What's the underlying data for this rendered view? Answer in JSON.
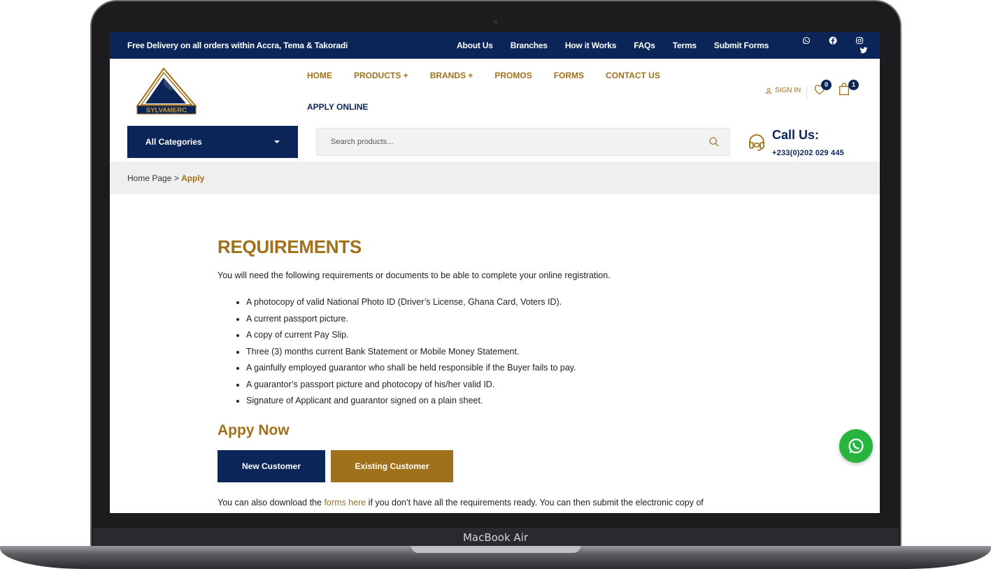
{
  "device": {
    "label": "MacBook Air"
  },
  "topbar": {
    "promo": "Free Delivery on all orders within Accra, Tema & Takoradi",
    "links": [
      "About Us",
      "Branches",
      "How it Works",
      "FAQs",
      "Terms",
      "Submit Forms"
    ],
    "social_icons": [
      "whatsapp-icon",
      "facebook-icon",
      "instagram-icon",
      "twitter-icon"
    ]
  },
  "header": {
    "logo_text": "SYLVAMERC",
    "nav": [
      "HOME",
      "PRODUCTS +",
      "BRANDS +",
      "PROMOS",
      "FORMS",
      "CONTACT US"
    ],
    "nav_second_row": "APPLY ONLINE",
    "signin": "SIGN IN",
    "wishlist_count": "0",
    "cart_count": "1"
  },
  "searchrow": {
    "categories_label": "All Categories",
    "search_placeholder": "Search products...",
    "call_title": "Call Us:",
    "call_number": "+233(0)202 029 445"
  },
  "breadcrumb": {
    "home": "Home Page",
    "separator": " > ",
    "current": "Apply"
  },
  "main": {
    "heading": "REQUIREMENTS",
    "intro": "You will need the following requirements or documents to be able to complete your online registration.",
    "requirements": [
      "A photocopy of valid National Photo ID (Driver’s License, Ghana Card, Voters ID).",
      "A current passport picture.",
      "A copy of current Pay Slip.",
      "Three (3) months current Bank Statement or Mobile Money Statement.",
      "A gainfully employed guarantor who shall be held responsible if the Buyer fails to pay.",
      "A guarantor’s passport picture and photocopy of his/her valid ID.",
      "Signature of Applicant and guarantor signed on a plain sheet."
    ],
    "apply_heading": "Appy Now",
    "btn_new": "New Customer",
    "btn_existing": "Existing Customer",
    "footer_pre": "You can also download the ",
    "footer_link": "forms here",
    "footer_post": " if you don’t have all the requirements ready. You can then submit the electronic copy of"
  },
  "colors": {
    "navy": "#0b2559",
    "gold": "#a1701b",
    "whatsapp": "#27b43f"
  }
}
